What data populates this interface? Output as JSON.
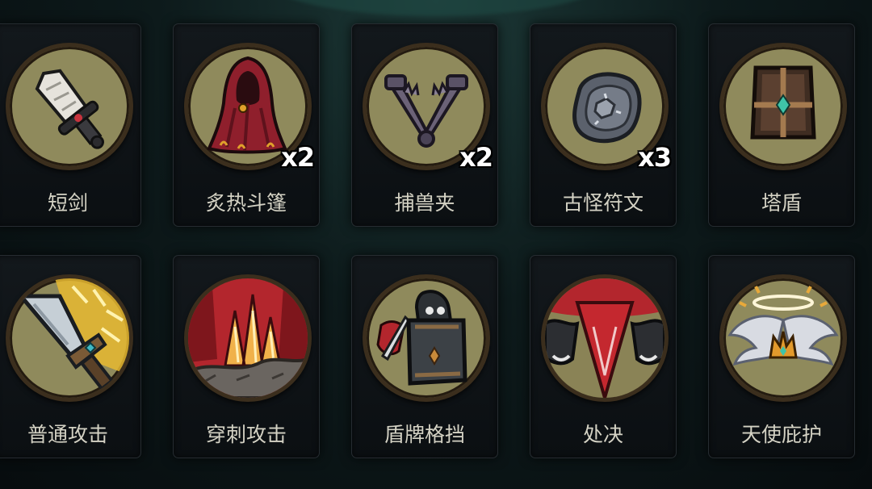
{
  "items": [
    {
      "label": "短剑",
      "count": "",
      "icon": "dagger-icon"
    },
    {
      "label": "炙热斗篷",
      "count": "x2",
      "icon": "cloak-icon"
    },
    {
      "label": "捕兽夹",
      "count": "x2",
      "icon": "trap-icon"
    },
    {
      "label": "古怪符文",
      "count": "x3",
      "icon": "rune-icon"
    },
    {
      "label": "塔盾",
      "count": "",
      "icon": "tower-shield-icon"
    }
  ],
  "skills": [
    {
      "label": "普通攻击",
      "icon": "basic-attack-icon"
    },
    {
      "label": "穿刺攻击",
      "icon": "pierce-attack-icon"
    },
    {
      "label": "盾牌格挡",
      "icon": "shield-block-icon"
    },
    {
      "label": "处决",
      "icon": "execute-icon"
    },
    {
      "label": "天使庇护",
      "icon": "angel-protection-icon"
    }
  ],
  "colors": {
    "medallion": "#8f8a5c",
    "rim": "#3b2e1d",
    "card": "#101519",
    "label": "#d4d2c4"
  }
}
